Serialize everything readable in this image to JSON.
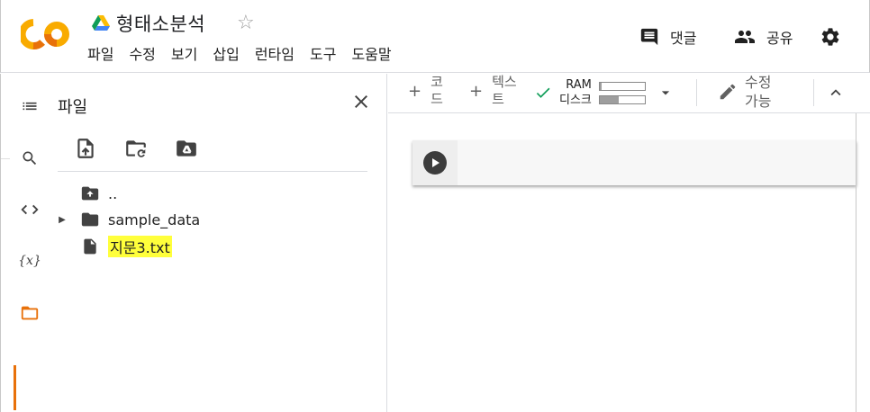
{
  "header": {
    "title": "형태소분석",
    "menu": [
      "파일",
      "수정",
      "보기",
      "삽입",
      "런타임",
      "도구",
      "도움말"
    ],
    "comment_label": "댓글",
    "share_label": "공유",
    "icons": {
      "logo": "colab-logo",
      "drive": "drive-icon",
      "star": "star-icon",
      "settings": "gear-icon"
    }
  },
  "rail": {
    "items": [
      "toc-icon",
      "search-icon",
      "code-icon",
      "variables-icon",
      "folder-icon"
    ],
    "variables_glyph": "{x}",
    "active_color": "#e8710a"
  },
  "files_panel": {
    "title": "파일",
    "tools": [
      "upload-file-icon",
      "refresh-folder-icon",
      "mount-drive-icon"
    ],
    "tree": [
      {
        "name": "..",
        "type": "parent-folder"
      },
      {
        "name": "sample_data",
        "type": "folder",
        "expandable": true
      },
      {
        "name": "지문3.txt",
        "type": "file",
        "highlighted": true
      }
    ],
    "highlight_color": "#ffff3b"
  },
  "toolbar": {
    "code_label_1": "코",
    "code_label_2": "드",
    "text_label_1": "텍스",
    "text_label_2": "트",
    "plus": "+",
    "ram_label": "RAM",
    "disk_label": "디스크",
    "ram_usage": 0.05,
    "disk_usage": 0.42,
    "edit_label_1": "수정",
    "edit_label_2": "가능",
    "status_color": "#0f9d58"
  }
}
